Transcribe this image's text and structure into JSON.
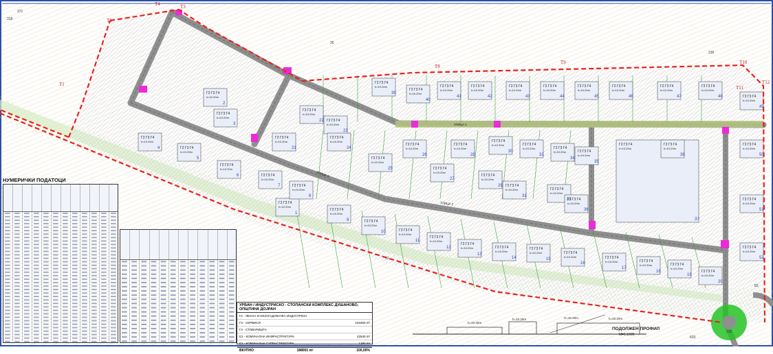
{
  "colors": {
    "boundary": "#e8211b",
    "road": "#8f8f8f",
    "green_strip": "#d7ecc4",
    "plot_line": "#3fa33f",
    "hatch": "#c7ccd6",
    "building": "#e9eef8",
    "junction": "#ec2bd8",
    "roundabout": "#27c327",
    "number": "#2345c9"
  },
  "table_title": "НУМЕРИЧКИ ПОДАТОЦИ",
  "legend": {
    "title": "УРБАН / ИНДУСТРИСКО - СТОПАНСКИ КОМПЛЕКС ДУШАНОВО, ОПШТИНА ДОЈРАН",
    "rows": [
      {
        "label": "Г2 - ЛЕСНА И НЕЗАГАДУВАЧКА ИНДУСТРИЈА",
        "value": ""
      },
      {
        "label": "Г3 - СЕРВИСИ",
        "value": "153460 m²"
      },
      {
        "label": "Г4 - СТОВАРИШТА",
        "value": ""
      },
      {
        "label": "Е1 - КОМУНАЛНА ИНФРАСТРУКТУРА",
        "value": "22540 m²"
      },
      {
        "label": "Е2 - КОМУНАЛНА СУПРАСТРУКТУРА",
        "value": "1380 m²"
      }
    ],
    "total_label": "ВКУПНО",
    "total_value": "188001 m²",
    "total_pct": "100,00%"
  },
  "section_title": "ПОДОЛЖЕН ПРОФИЛ",
  "section_scale": "M=1:1000",
  "section_dims": [
    "h=10.20m",
    "h=10.20m",
    "H=10.20m",
    "h=10.20m"
  ],
  "plot_label": "Г2 Г3 Г4",
  "plot_height": "h=10.20m",
  "corner_labels": [
    "T1",
    "T2",
    "T3",
    "T4",
    "T8",
    "T9",
    "T10",
    "T11",
    "T12"
  ],
  "plot_numbers": [
    "1",
    "2",
    "3",
    "4",
    "5",
    "6",
    "7",
    "8",
    "9",
    "10",
    "11",
    "12",
    "13",
    "14",
    "15",
    "16",
    "17",
    "18",
    "19",
    "20",
    "21",
    "22",
    "23",
    "24",
    "25",
    "26",
    "27",
    "28",
    "29",
    "30",
    "31",
    "32",
    "33",
    "34",
    "35",
    "36",
    "37",
    "38",
    "39",
    "40",
    "41",
    "42",
    "43",
    "44",
    "45",
    "46",
    "47",
    "48",
    "49",
    "50",
    "51",
    "52"
  ],
  "road_labels": [
    "УЛИЦА 1",
    "УЛИЦА 2",
    "УЛИЦА 3"
  ],
  "misc_numbers": [
    "371",
    "318",
    "26",
    "236",
    "239",
    "83",
    "633",
    "72"
  ]
}
